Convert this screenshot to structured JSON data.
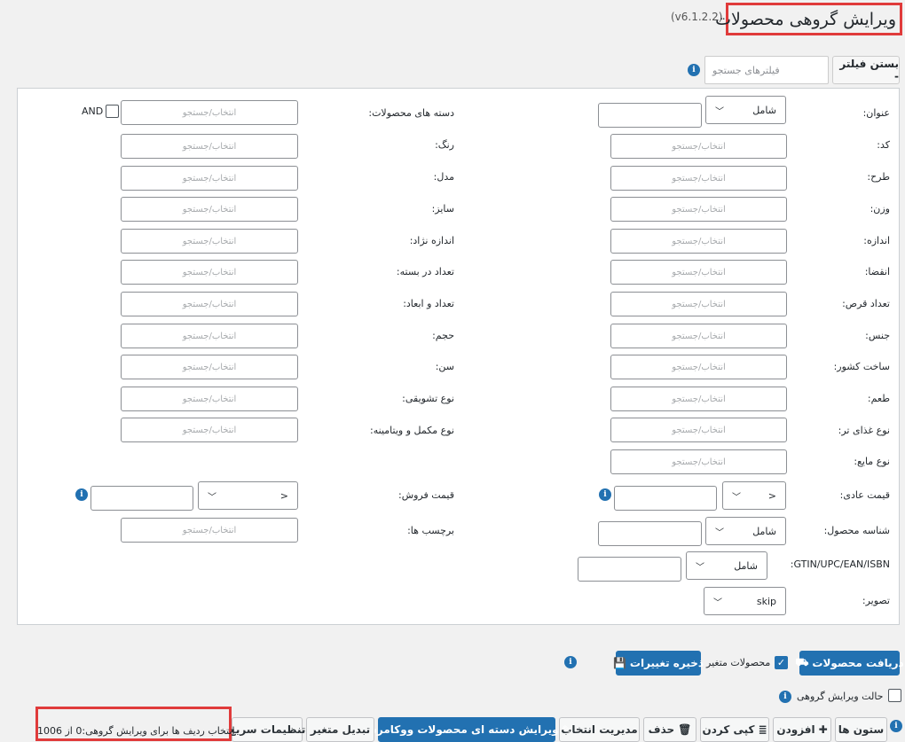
{
  "header": {
    "title": "ویرایش گروهی محصولات",
    "version": "(v6.1.2.2)"
  },
  "filter_bar": {
    "toggle_label": "بستن فیلتر -",
    "search_placeholder": "فیلترهای جستجو"
  },
  "common": {
    "select_placeholder": "انتخاب/جستجو",
    "and_label": "AND"
  },
  "right_fields": [
    {
      "label": "عنوان:"
    },
    {
      "label": "کد:"
    },
    {
      "label": "طرح:"
    },
    {
      "label": "وزن:"
    },
    {
      "label": "اندازه:"
    },
    {
      "label": "انقضا:"
    },
    {
      "label": "تعداد قرص:"
    },
    {
      "label": "جنس:"
    },
    {
      "label": "ساخت کشور:"
    },
    {
      "label": "طعم:"
    },
    {
      "label": "نوع غذای تر:"
    },
    {
      "label": "نوع مایع:"
    },
    {
      "label": "قیمت عادی:"
    },
    {
      "label": "شناسه محصول:"
    },
    {
      "label": "GTIN/UPC/EAN/ISBN:"
    },
    {
      "label": "تصویر:"
    }
  ],
  "left_fields": [
    {
      "label": "دسته های محصولات:"
    },
    {
      "label": "رنگ:"
    },
    {
      "label": "مدل:"
    },
    {
      "label": "سایز:"
    },
    {
      "label": "اندازه نژاد:"
    },
    {
      "label": "تعداد در بسته:"
    },
    {
      "label": "تعداد و ابعاد:"
    },
    {
      "label": "حجم:"
    },
    {
      "label": "سن:"
    },
    {
      "label": "نوع تشویقی:"
    },
    {
      "label": "نوع مکمل و ویتامینه:"
    },
    {
      "label": "قیمت فروش:"
    },
    {
      "label": "برچسب ها:"
    }
  ],
  "selects": {
    "title_op": "شامل",
    "sku_op": "شامل",
    "gtin_op": "شامل",
    "regular_price_op": ">",
    "sale_price_op": ">",
    "image_op": "skip"
  },
  "actions": {
    "fetch_products": "دریافت محصولات",
    "variable_products": "محصولات متغیر",
    "save_changes": "ذخیره تغییرات",
    "bulk_edit_mode": "حالت ویرایش گروهی"
  },
  "toolbar": {
    "columns": "ستون ها",
    "add": "افزودن",
    "duplicate": "کپی کردن",
    "delete": "حذف",
    "manage_selection": "مدیریت انتخاب",
    "bulk_edit_categories": "ویرایش دسته ای محصولات ووکامرس",
    "convert_variable": "تبدیل متغیر",
    "quick_settings": "تنظیمات سریع",
    "selection_status": "انتخاب ردیف ها برای ویرایش گروهی:0 از 1006"
  }
}
